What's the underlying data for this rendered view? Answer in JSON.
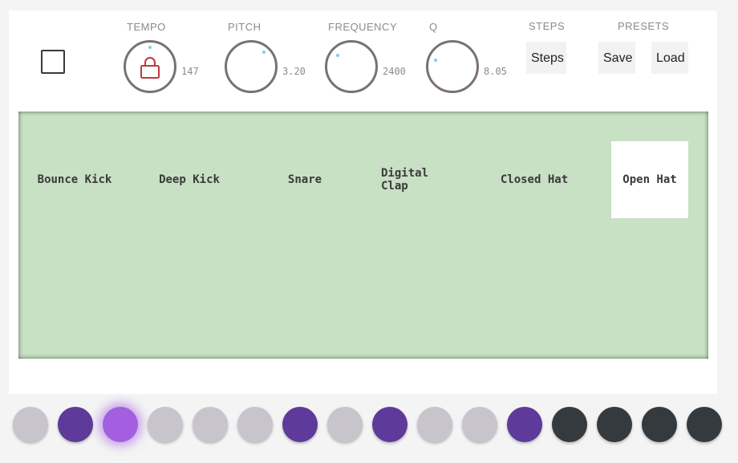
{
  "knobs": [
    {
      "label": "TEMPO",
      "value": "147",
      "locked": true
    },
    {
      "label": "PITCH",
      "value": "3.20"
    },
    {
      "label": "FREQUENCY",
      "value": "2400"
    },
    {
      "label": "Q",
      "value": "8.05"
    }
  ],
  "steps": {
    "label": "STEPS",
    "button": "Steps"
  },
  "presets": {
    "label": "PRESETS",
    "save": "Save",
    "load": "Load"
  },
  "pads": [
    {
      "label": "Bounce Kick",
      "active": false
    },
    {
      "label": "Deep Kick",
      "active": false
    },
    {
      "label": "Snare",
      "active": false
    },
    {
      "label": "Digital Clap",
      "active": false
    },
    {
      "label": "Closed Hat",
      "active": false
    },
    {
      "label": "Open Hat",
      "active": true
    }
  ],
  "sequencer": [
    "off",
    "on",
    "current",
    "off",
    "off",
    "off",
    "on",
    "off",
    "on",
    "off",
    "off",
    "on",
    "disabled",
    "disabled",
    "disabled",
    "disabled"
  ],
  "colors": {
    "step_off": "#c7c5cb",
    "step_on": "#5e3a9a",
    "step_current": "#a35fe0",
    "step_disabled": "#343a3d",
    "pad_area": "#c8e0c4",
    "knob_indicator": "#7ecfe6",
    "lock": "#c0393b"
  }
}
